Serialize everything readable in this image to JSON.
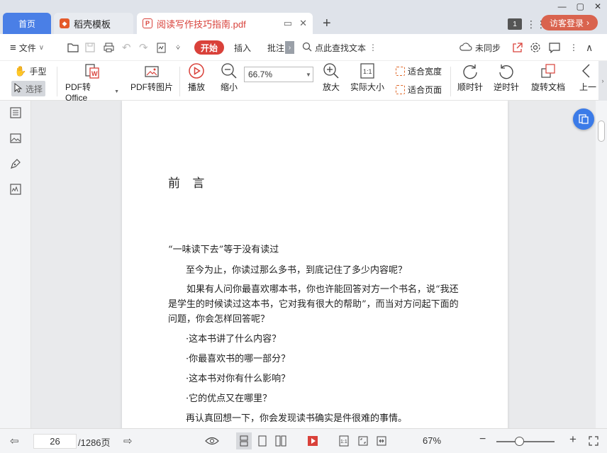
{
  "tabs": {
    "home": "首页",
    "daoke": "稻壳模板",
    "pdf": "阅读写作技巧指南.pdf"
  },
  "header": {
    "page_badge": "1",
    "visitor_login": "访客登录"
  },
  "menubar": {
    "file": "文件",
    "start": "开始",
    "insert": "插入",
    "annotate": "批注",
    "search_placeholder": "点此查找文本",
    "sync": "未同步"
  },
  "toolbar": {
    "hand": "手型",
    "select": "选择",
    "pdf_to_office": "PDF转Office",
    "pdf_to_image": "PDF转图片",
    "play": "播放",
    "zoom_out": "缩小",
    "zoom_value": "66.7%",
    "zoom_in": "放大",
    "actual_size": "实际大小",
    "fit_width": "适合宽度",
    "fit_page": "适合页面",
    "rotate_cw": "顺时针",
    "rotate_ccw": "逆时针",
    "rotate_doc": "旋转文档",
    "prev": "上一"
  },
  "document": {
    "heading": "前 言",
    "subtitle": "“一味读下去”等于没有读过",
    "line1": "至今为止，你读过那么多书，到底记住了多少内容呢？",
    "para2": "如果有人问你最喜欢哪本书，你也许能回答对方一个书名，说“我还是学生的时候读过这本书，它对我有很大的帮助”，而当对方问起下面的问题，你会怎样回答呢？",
    "q1": "·这本书讲了什么内容？",
    "q2": "·你最喜欢书的哪一部分？",
    "q3": "·这本书对你有什么影响？",
    "q4": "·它的优点又在哪里？",
    "last": "再认真回想一下，你会发现读书确实是件很难的事情。"
  },
  "statusbar": {
    "current_page": "26",
    "total_pages": "/1286页",
    "zoom": "67%"
  },
  "colors": {
    "accent_blue": "#4a7fe6",
    "accent_red": "#d9413a",
    "visitor_btn": "#d9634e"
  }
}
